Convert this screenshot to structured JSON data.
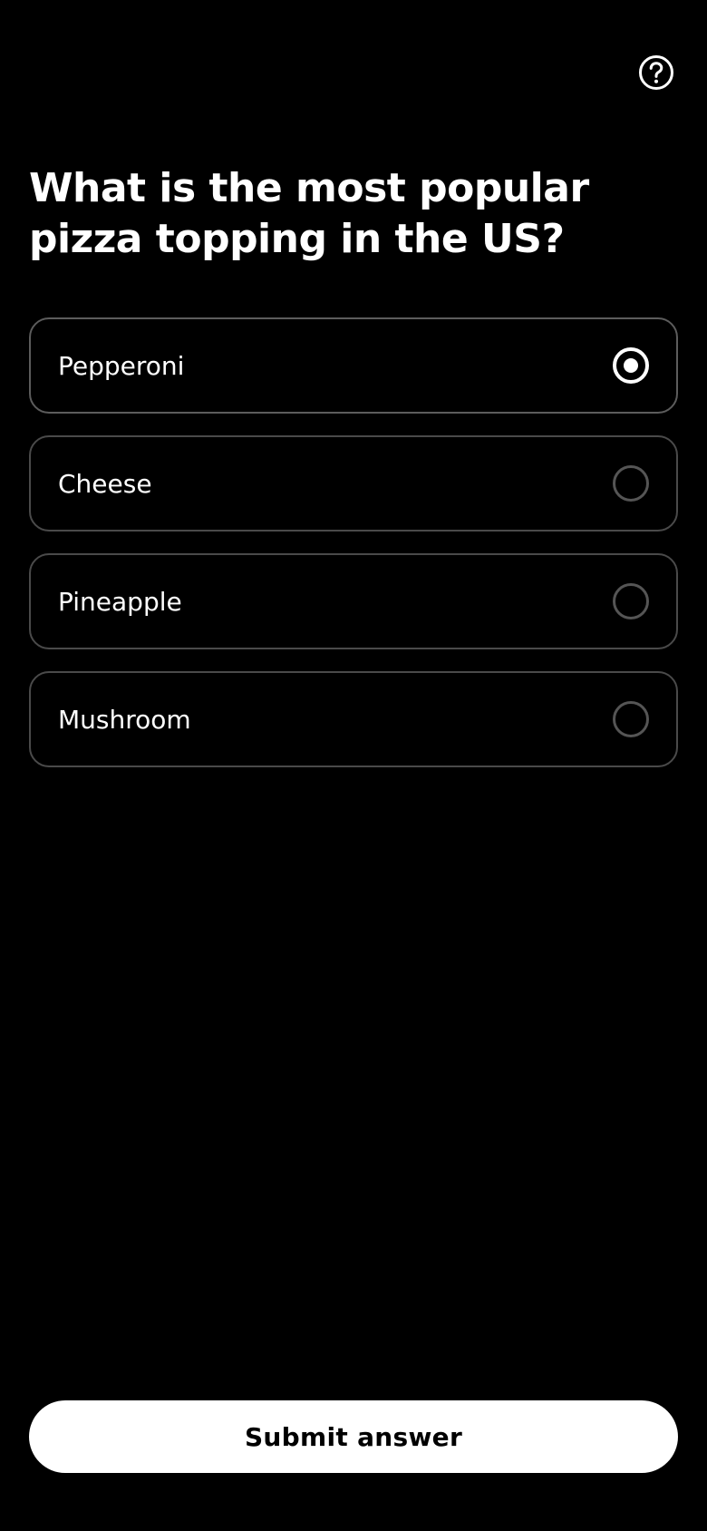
{
  "header": {
    "help_icon": "question-circle-icon"
  },
  "question": {
    "text": "What is the most popular pizza topping in the US?"
  },
  "options": [
    {
      "label": "Pepperoni",
      "selected": true
    },
    {
      "label": "Cheese",
      "selected": false
    },
    {
      "label": "Pineapple",
      "selected": false
    },
    {
      "label": "Mushroom",
      "selected": false
    }
  ],
  "submit": {
    "label": "Submit answer"
  },
  "colors": {
    "background": "#000000",
    "text": "#ffffff",
    "option_border": "#4a4a4a",
    "radio_unselected": "#555555",
    "button_bg": "#ffffff",
    "button_text": "#000000"
  }
}
